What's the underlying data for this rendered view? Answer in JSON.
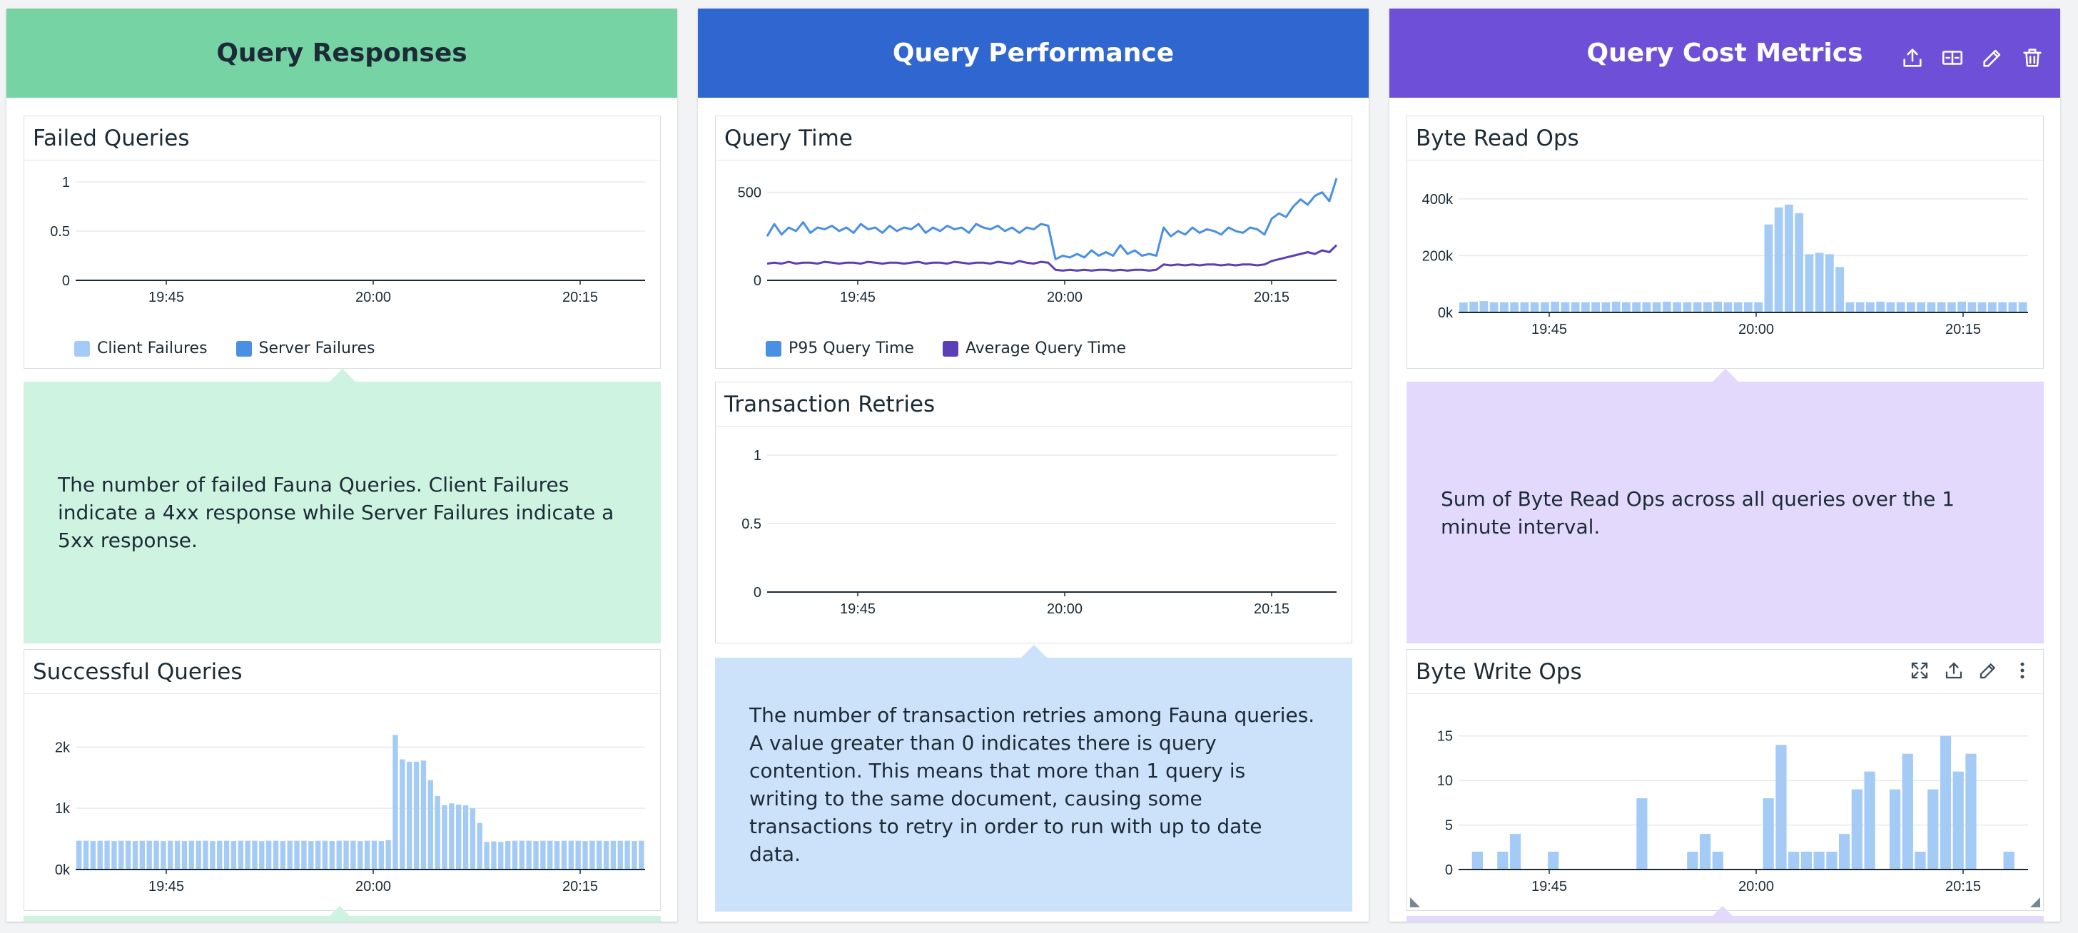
{
  "groups": [
    {
      "title": "Query Responses",
      "color": "#76d3a4",
      "widgets": [
        {
          "title": "Failed Queries",
          "chart_data": {
            "type": "bar",
            "x_ticks": [
              "19:45",
              "20:00",
              "20:15"
            ],
            "y_ticks": [
              "0",
              "0.5",
              "1"
            ],
            "ylim": [
              0,
              1
            ],
            "series": [
              {
                "name": "Client Failures",
                "color": "#a4cbf5",
                "values": []
              },
              {
                "name": "Server Failures",
                "color": "#4a90e2",
                "values": []
              }
            ]
          },
          "note": "The number of failed Fauna Queries. Client Failures indicate a 4xx response while Server Failures indicate a 5xx response."
        },
        {
          "title": "Successful Queries",
          "chart_data": {
            "type": "bar",
            "x_ticks": [
              "19:45",
              "20:00",
              "20:15"
            ],
            "y_ticks": [
              "0k",
              "1k",
              "2k"
            ],
            "ylim": [
              0,
              2400
            ],
            "values": [
              470,
              470,
              465,
              470,
              470,
              465,
              470,
              470,
              465,
              470,
              470,
              470,
              465,
              470,
              470,
              465,
              470,
              470,
              470,
              465,
              470,
              470,
              465,
              470,
              470,
              470,
              465,
              470,
              470,
              465,
              470,
              470,
              470,
              465,
              470,
              470,
              465,
              470,
              470,
              470,
              465,
              470,
              470,
              465,
              480,
              2200,
              1800,
              1760,
              1760,
              1780,
              1460,
              1200,
              1050,
              1080,
              1060,
              1050,
              1000,
              760,
              450,
              460,
              450,
              465,
              470,
              470,
              470,
              465,
              470,
              470,
              465,
              470,
              470,
              470,
              465,
              470,
              470,
              465,
              470,
              470,
              470,
              465,
              470
            ]
          }
        }
      ]
    },
    {
      "title": "Query Performance",
      "color": "#2f66cf",
      "widgets": [
        {
          "title": "Query Time",
          "chart_data": {
            "type": "line",
            "x_ticks": [
              "19:45",
              "20:00",
              "20:15"
            ],
            "y_ticks": [
              "0",
              "500"
            ],
            "ylim": [
              0,
              620
            ],
            "series": [
              {
                "name": "P95 Query Time",
                "color": "#4a90e2",
                "values": [
                  250,
                  320,
                  260,
                  300,
                  280,
                  330,
                  270,
                  300,
                  290,
                  310,
                  280,
                  300,
                  270,
                  320,
                  290,
                  300,
                  270,
                  310,
                  280,
                  300,
                  290,
                  320,
                  270,
                  300,
                  280,
                  310,
                  290,
                  300,
                  270,
                  320,
                  300,
                  290,
                  310,
                  280,
                  300,
                  270,
                  300,
                  290,
                  320,
                  310,
                  120,
                  140,
                  130,
                  150,
                  130,
                  170,
                  140,
                  160,
                  140,
                  200,
                  150,
                  170,
                  140,
                  150,
                  140,
                  300,
                  250,
                  280,
                  260,
                  300,
                  270,
                  290,
                  280,
                  260,
                  300,
                  280,
                  270,
                  300,
                  290,
                  260,
                  350,
                  380,
                  360,
                  420,
                  460,
                  430,
                  480,
                  500,
                  450,
                  580
                ]
              },
              {
                "name": "Average Query Time",
                "color": "#5b3fb8",
                "values": [
                  95,
                  100,
                  95,
                  105,
                  95,
                  100,
                  100,
                  95,
                  105,
                  100,
                  95,
                  100,
                  100,
                  95,
                  105,
                  100,
                  95,
                  100,
                  100,
                  95,
                  100,
                  105,
                  95,
                  100,
                  100,
                  95,
                  105,
                  100,
                  95,
                  100,
                  100,
                  95,
                  105,
                  100,
                  95,
                  110,
                  100,
                  95,
                  105,
                  100,
                  60,
                  55,
                  60,
                  55,
                  60,
                  55,
                  60,
                  60,
                  55,
                  60,
                  55,
                  60,
                  60,
                  55,
                  60,
                  90,
                  85,
                  90,
                  85,
                  90,
                  85,
                  90,
                  90,
                  85,
                  90,
                  85,
                  90,
                  90,
                  85,
                  90,
                  110,
                  120,
                  130,
                  140,
                  150,
                  160,
                  150,
                  170,
                  160,
                  200
                ]
              }
            ]
          }
        },
        {
          "title": "Transaction Retries",
          "chart_data": {
            "type": "bar",
            "x_ticks": [
              "19:45",
              "20:00",
              "20:15"
            ],
            "y_ticks": [
              "0",
              "0.5",
              "1"
            ],
            "ylim": [
              0,
              1
            ],
            "values": []
          },
          "note": "The number of transaction retries among Fauna queries. A value greater than 0 indicates there is query contention. This means that more than 1 query is writing to the same document, causing some transactions to retry in order to run with up to date data."
        }
      ]
    },
    {
      "title": "Query Cost Metrics",
      "color": "#6e50d8",
      "widgets": [
        {
          "title": "Byte Read Ops",
          "chart_data": {
            "type": "bar",
            "x_ticks": [
              "19:45",
              "20:00",
              "20:15"
            ],
            "y_ticks": [
              "0k",
              "200k",
              "400k"
            ],
            "ylim": [
              0,
              460000
            ],
            "values": [
              35000,
              38000,
              40000,
              36000,
              36000,
              36000,
              36000,
              36000,
              36000,
              38000,
              36000,
              36000,
              36000,
              36000,
              36000,
              38000,
              36000,
              36000,
              36000,
              36000,
              38000,
              36000,
              36000,
              36000,
              36000,
              38000,
              36000,
              36000,
              36000,
              36000,
              310000,
              370000,
              380000,
              350000,
              205000,
              210000,
              205000,
              160000,
              36000,
              36000,
              36000,
              38000,
              36000,
              36000,
              36000,
              36000,
              36000,
              36000,
              36000,
              38000,
              36000,
              36000,
              36000,
              36000,
              36000,
              36000
            ]
          },
          "note": "Sum of Byte Read Ops across all queries over the 1 minute interval."
        },
        {
          "title": "Byte Write Ops",
          "chart_data": {
            "type": "bar",
            "x_ticks": [
              "19:45",
              "20:00",
              "20:15"
            ],
            "y_ticks": [
              "0",
              "5",
              "10",
              "15"
            ],
            "ylim": [
              0,
              16.5
            ],
            "values": [
              0,
              2,
              0,
              2,
              4,
              0,
              0,
              2,
              0,
              0,
              0,
              0,
              0,
              0,
              8,
              0,
              0,
              0,
              2,
              4,
              2,
              0,
              0,
              0,
              8,
              14,
              2,
              2,
              2,
              2,
              4,
              9,
              11,
              0,
              9,
              13,
              2,
              9,
              15,
              11,
              13,
              0,
              0,
              2,
              0
            ]
          }
        }
      ]
    }
  ],
  "colors": {
    "responses_note_bg": "#cef3e1",
    "performance_note_bg": "#cbe2fa",
    "cost_note_bg": "#e3d9fc",
    "bar": "#a4cbf5",
    "axis": "#1c2b36",
    "grid": "#e6e9ee"
  },
  "icons": {
    "group_tools": [
      "export-icon",
      "split-icon",
      "edit-icon",
      "delete-icon"
    ],
    "widget_tools": [
      "expand-icon",
      "export-icon",
      "edit-icon",
      "more-vertical-icon"
    ]
  }
}
